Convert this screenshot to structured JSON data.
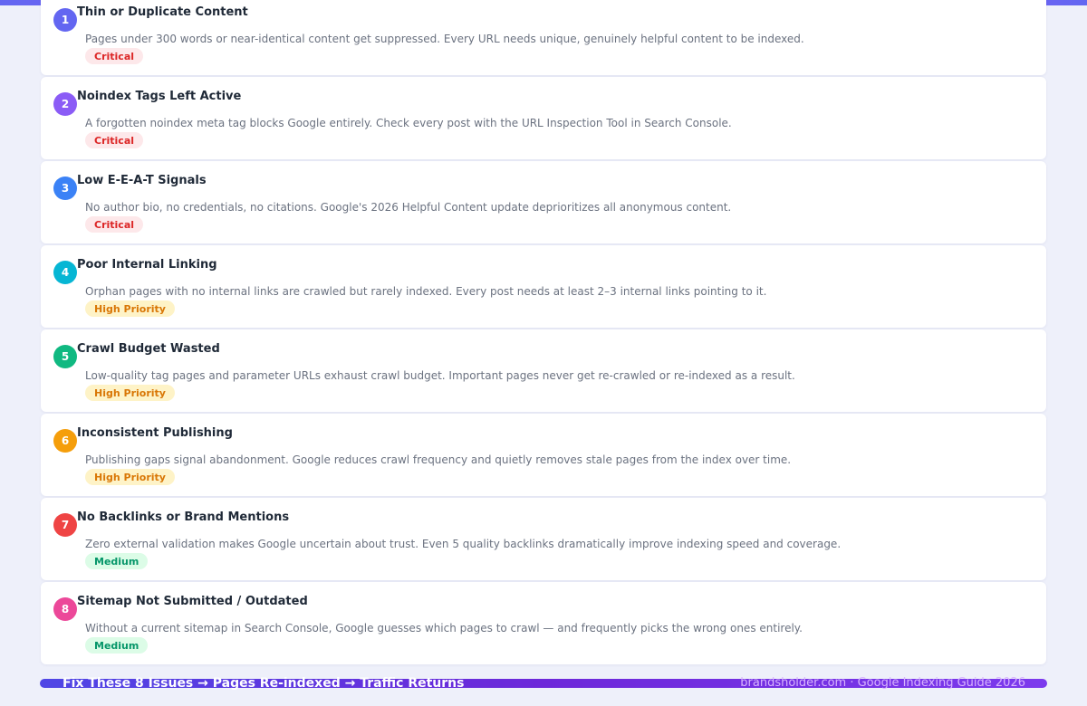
{
  "issues": [
    {
      "number": "1",
      "title": "Thin or Duplicate Content",
      "description": "Pages under 300 words or near-identical content get suppressed. Every URL needs unique, genuinely helpful content to be indexed.",
      "badge": "Critical",
      "color": "#6366f1",
      "severity": "critical"
    },
    {
      "number": "2",
      "title": "Noindex Tags Left Active",
      "description": "A forgotten noindex meta tag blocks Google entirely. Check every post with the URL Inspection Tool in Search Console.",
      "badge": "Critical",
      "color": "#8b5cf6",
      "severity": "critical"
    },
    {
      "number": "3",
      "title": "Low E-E-A-T Signals",
      "description": "No author bio, no credentials, no citations. Google's 2026 Helpful Content update deprioritizes all anonymous content.",
      "badge": "Critical",
      "color": "#3b82f6",
      "severity": "critical"
    },
    {
      "number": "4",
      "title": "Poor Internal Linking",
      "description": "Orphan pages with no internal links are crawled but rarely indexed. Every post needs at least 2–3 internal links pointing to it.",
      "badge": "High Priority",
      "color": "#06b6d4",
      "severity": "high"
    },
    {
      "number": "5",
      "title": "Crawl Budget Wasted",
      "description": "Low-quality tag pages and parameter URLs exhaust crawl budget. Important pages never get re-crawled or re-indexed as a result.",
      "badge": "High Priority",
      "color": "#10b981",
      "severity": "high"
    },
    {
      "number": "6",
      "title": "Inconsistent Publishing",
      "description": "Publishing gaps signal abandonment. Google reduces crawl frequency and quietly removes stale pages from the index over time.",
      "badge": "High Priority",
      "color": "#f59e0b",
      "severity": "high"
    },
    {
      "number": "7",
      "title": "No Backlinks or Brand Mentions",
      "description": "Zero external validation makes Google uncertain about trust. Even 5 quality backlinks dramatically improve indexing speed and coverage.",
      "badge": "Medium",
      "color": "#ef4444",
      "severity": "medium"
    },
    {
      "number": "8",
      "title": "Sitemap Not Submitted / Outdated",
      "description": "Without a current sitemap in Search Console, Google guesses which pages to crawl — and frequently picks the wrong ones entirely.",
      "badge": "Medium",
      "color": "#ec4899",
      "severity": "medium"
    }
  ],
  "badge_styles": {
    "critical": {
      "bg": "#fde8ea",
      "fg": "#dc2626"
    },
    "high": {
      "bg": "#fef3c7",
      "fg": "#d97706"
    },
    "medium": {
      "bg": "#dcfce7",
      "fg": "#059669"
    }
  },
  "footer": {
    "headline": "Fix These 8 Issues → Pages Re-indexed → Traffic Returns",
    "credit": "brandsholder.com · Google Indexing Guide 2026"
  }
}
